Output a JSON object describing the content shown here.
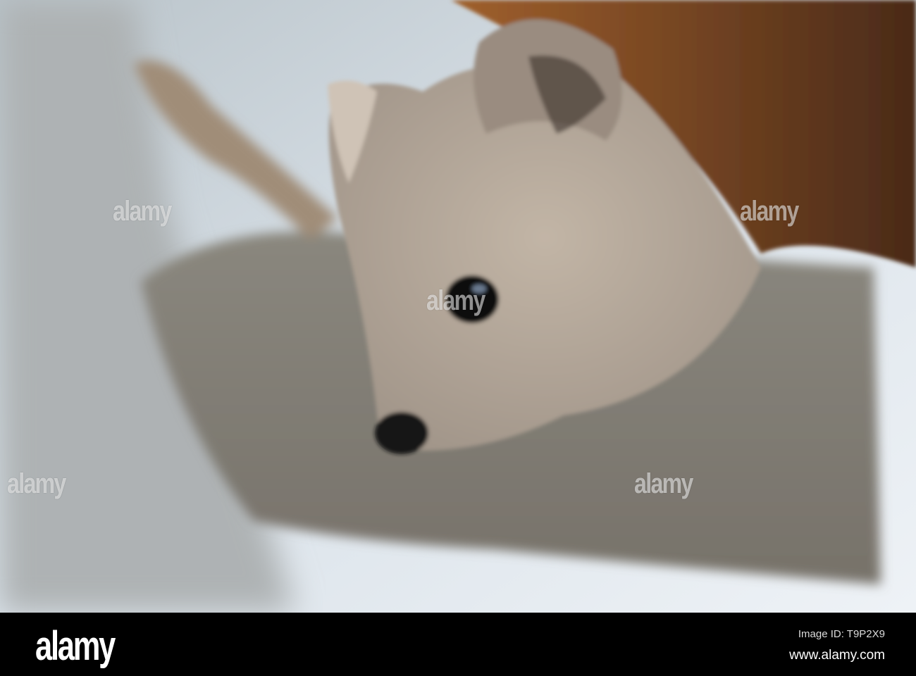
{
  "watermark": {
    "text": "alamy"
  },
  "footer": {
    "logo": "alamy",
    "image_id": "Image ID: T9P2X9",
    "url": "www.alamy.com"
  },
  "colors": {
    "background_sky": "#c9d3dc",
    "branch": "#8a8478",
    "fur_face": "#b8aa9a",
    "fur_body": "#8a4a1e",
    "footer_bg": "#000000"
  }
}
